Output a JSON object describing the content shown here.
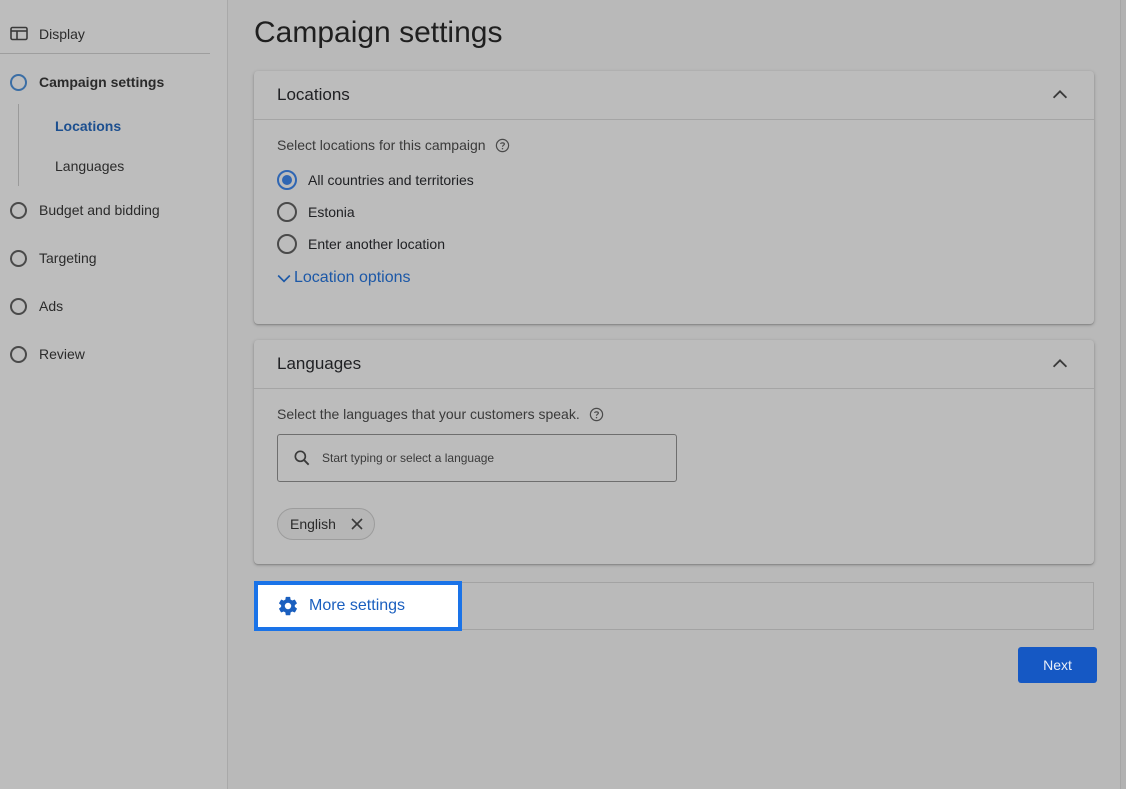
{
  "sidebar": {
    "top": {
      "label": "Display",
      "icon": "display-icon"
    },
    "items": [
      {
        "label": "Campaign settings",
        "active": true
      },
      {
        "label": "Budget and bidding"
      },
      {
        "label": "Targeting"
      },
      {
        "label": "Ads"
      },
      {
        "label": "Review"
      }
    ],
    "subitems": [
      {
        "label": "Locations",
        "active": true
      },
      {
        "label": "Languages"
      }
    ]
  },
  "main": {
    "title": "Campaign settings",
    "locations": {
      "title": "Locations",
      "helper": "Select locations for this campaign",
      "options": [
        {
          "label": "All countries and territories",
          "selected": true
        },
        {
          "label": "Estonia",
          "selected": false
        },
        {
          "label": "Enter another location",
          "selected": false
        }
      ],
      "more_options": "Location options"
    },
    "languages": {
      "title": "Languages",
      "helper": "Select the languages that your customers speak.",
      "search_placeholder": "Start typing or select a language",
      "chips": [
        {
          "label": "English"
        }
      ]
    },
    "more_settings": "More settings",
    "next": "Next"
  },
  "colors": {
    "accent": "#1a73e8",
    "link": "#1c58a7",
    "primary_button": "#1558c4",
    "highlight_border": "#1a73e8"
  }
}
